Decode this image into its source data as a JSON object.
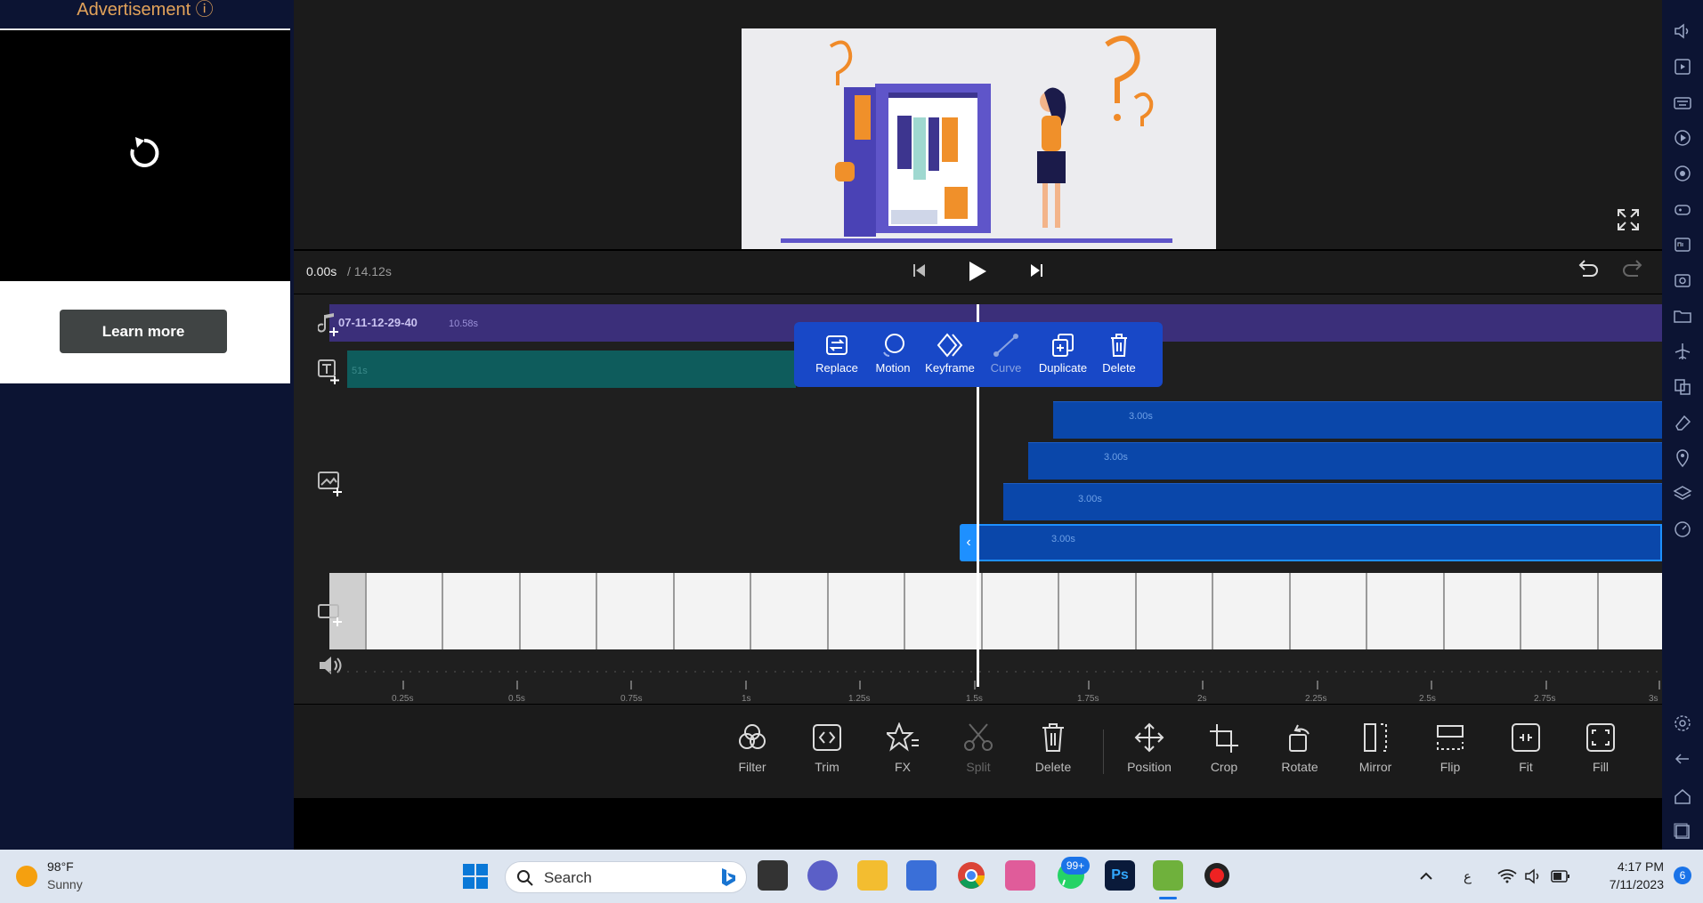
{
  "ad": {
    "header": "Advertisement ⓘ",
    "learn_more": "Learn more"
  },
  "player": {
    "current_time": "0.00s",
    "total_time": "/ 14.12s"
  },
  "tracks": {
    "audio_label": "07-11-12-29-40",
    "audio_duration": "10.58s",
    "text_duration": "51s",
    "clip_durations": [
      "3.00s",
      "3.00s",
      "3.00s",
      "3.00s"
    ]
  },
  "clip_popup": {
    "items": [
      {
        "label": "Replace",
        "icon": "replace-icon",
        "enabled": true
      },
      {
        "label": "Motion",
        "icon": "motion-icon",
        "enabled": true
      },
      {
        "label": "Keyframe",
        "icon": "keyframe-icon",
        "enabled": true
      },
      {
        "label": "Curve",
        "icon": "curve-icon",
        "enabled": false
      },
      {
        "label": "Duplicate",
        "icon": "duplicate-icon",
        "enabled": true
      },
      {
        "label": "Delete",
        "icon": "delete-icon",
        "enabled": true
      }
    ]
  },
  "ruler": {
    "ticks": [
      "0.25s",
      "0.5s",
      "0.75s",
      "1s",
      "1.25s",
      "1.5s",
      "1.75s",
      "2s",
      "2.25s",
      "2.5s",
      "2.75s",
      "3s"
    ]
  },
  "toolbar": {
    "items": [
      {
        "label": "Filter",
        "icon": "filter-icon",
        "enabled": true
      },
      {
        "label": "Trim",
        "icon": "trim-icon",
        "enabled": true
      },
      {
        "label": "FX",
        "icon": "fx-icon",
        "enabled": true
      },
      {
        "label": "Split",
        "icon": "scissors-icon",
        "enabled": false
      },
      {
        "label": "Delete",
        "icon": "delete-icon",
        "enabled": true
      },
      {
        "label": "Position",
        "icon": "move-icon",
        "enabled": true
      },
      {
        "label": "Crop",
        "icon": "crop-icon",
        "enabled": true
      },
      {
        "label": "Rotate",
        "icon": "rotate-icon",
        "enabled": true
      },
      {
        "label": "Mirror",
        "icon": "mirror-icon",
        "enabled": true
      },
      {
        "label": "Flip",
        "icon": "flip-icon",
        "enabled": true
      },
      {
        "label": "Fit",
        "icon": "fit-icon",
        "enabled": true
      },
      {
        "label": "Fill",
        "icon": "fill-icon",
        "enabled": true
      }
    ]
  },
  "taskbar": {
    "weather_temp": "98°F",
    "weather_desc": "Sunny",
    "search_placeholder": "Search",
    "whatsapp_badge": "99+",
    "lang": "ع",
    "time": "4:17 PM",
    "date": "7/11/2023",
    "notif_count": "6"
  },
  "colors": {
    "accent_blue": "#1848c7",
    "clip_blue": "#0a47aa",
    "audio_track": "#3b2f7a",
    "text_track": "#0e5c5c"
  }
}
